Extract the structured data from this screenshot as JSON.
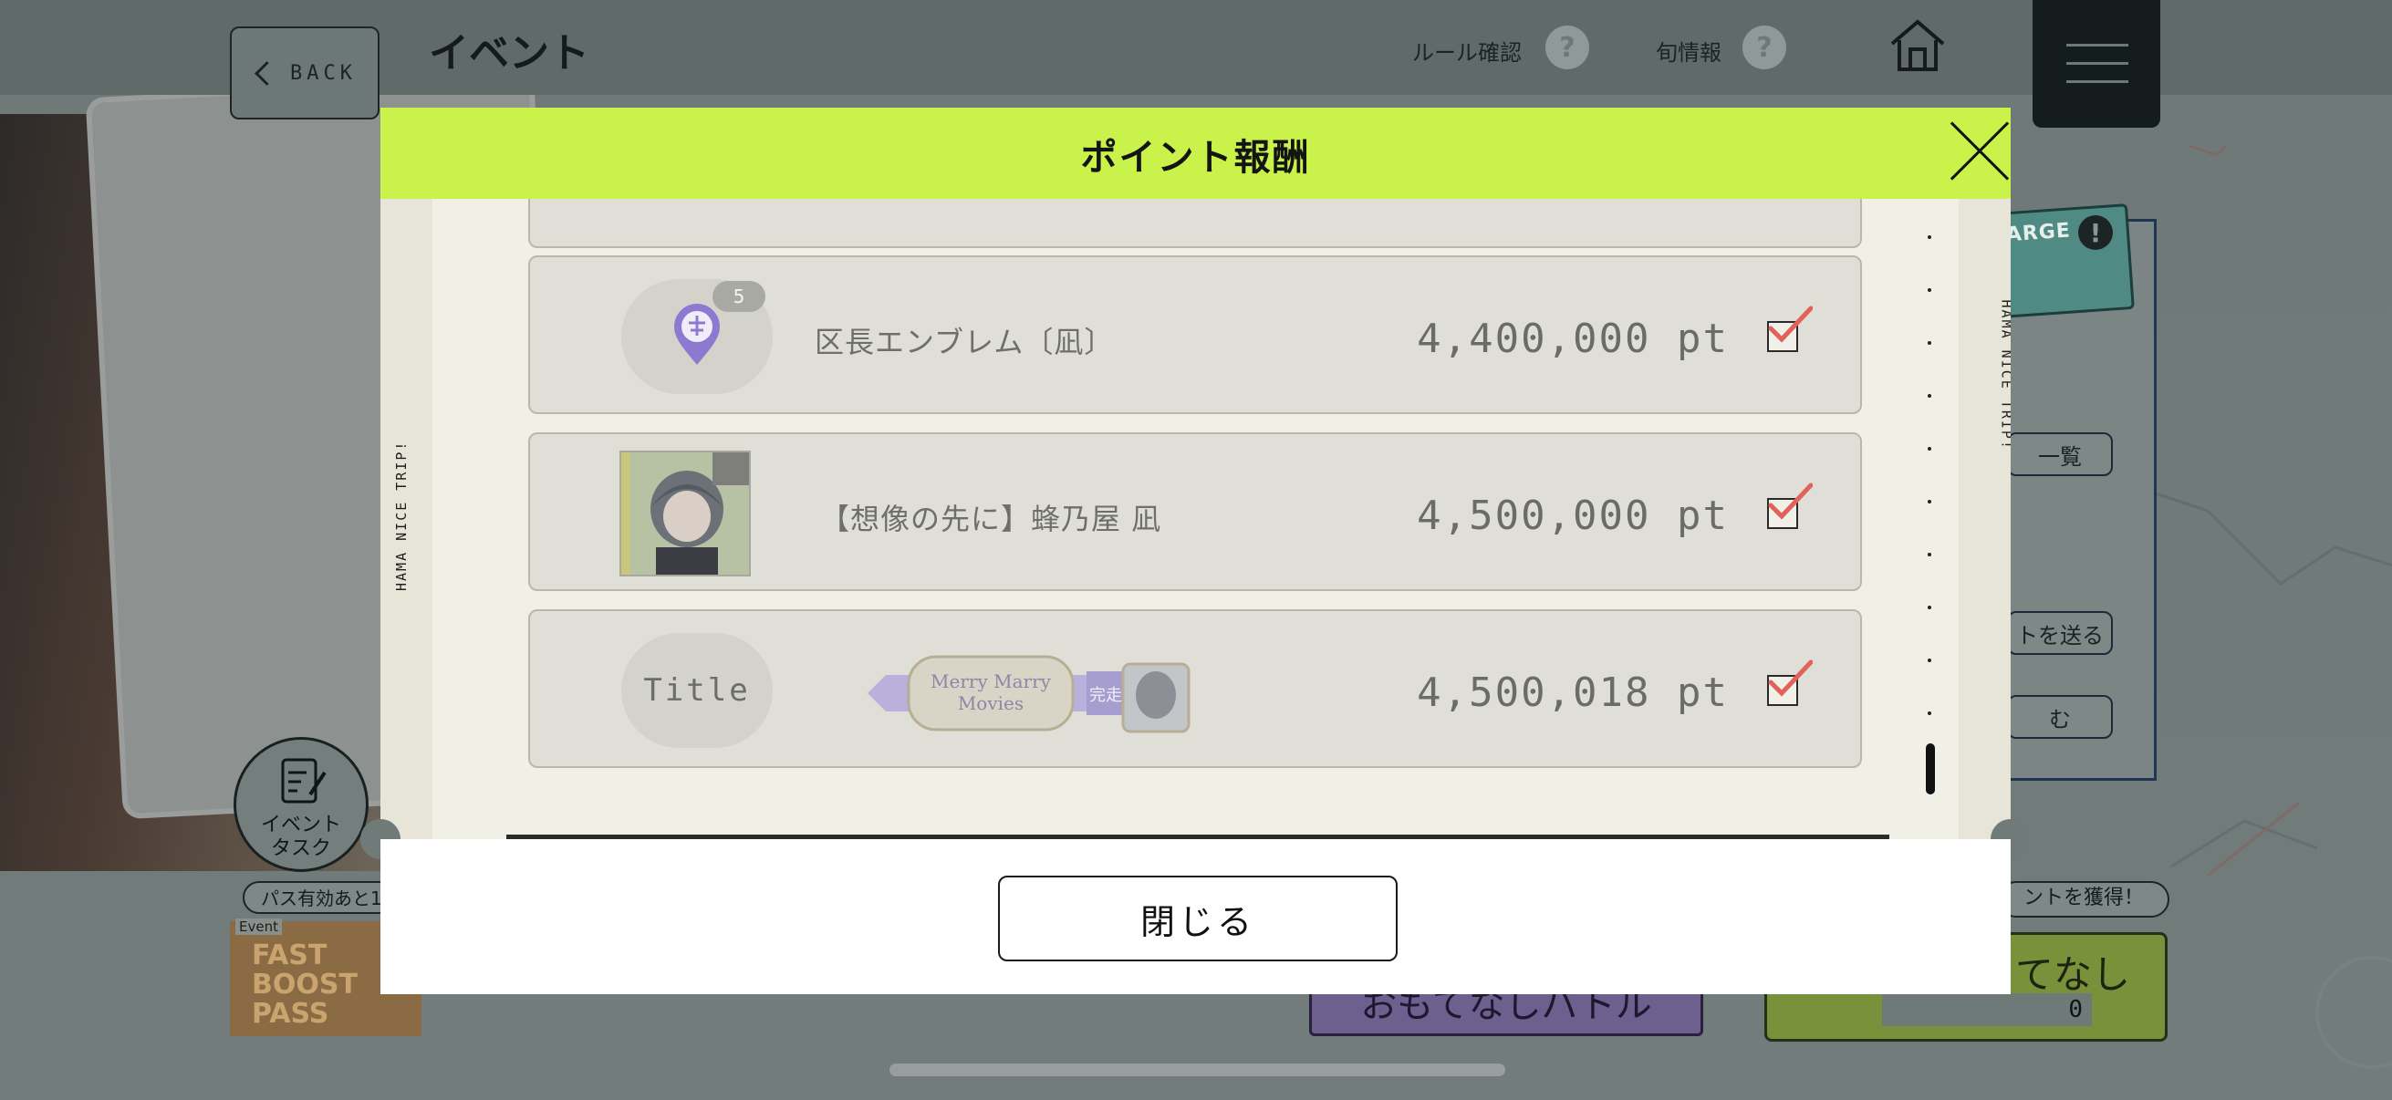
{
  "header": {
    "back_label": "BACK",
    "page_title": "イベント",
    "rules_label": "ルール確認",
    "news_label": "旬情報",
    "help_glyph": "?"
  },
  "background": {
    "event_task_label_1": "イベント",
    "event_task_label_2": "タスク",
    "pass_text": "パス有効あと1",
    "fastpass_event": "Event",
    "fastpass_text": "FAST BOOST PASS",
    "right_panel_badge": "ARGE",
    "right_panel_btn_1": "一覧",
    "right_panel_btn_2": "トを送る",
    "right_panel_btn_3": "む",
    "point_get_text": "ントを獲得！",
    "battle_label": "おもてなしバトル",
    "omotenashi_label": "てなし",
    "counter_value": "0"
  },
  "modal": {
    "title": "ポイント報酬",
    "side_text": "HAMA NICE TRIP!",
    "close_label": "閉じる",
    "rewards": [
      {
        "type": "emblem",
        "name": "区長エンブレム〔凪〕",
        "count": "5",
        "points": "4,400,000 pt",
        "claimed": true
      },
      {
        "type": "card",
        "name": "【想像の先に】蜂乃屋 凪",
        "points": "4,500,000 pt",
        "claimed": true
      },
      {
        "type": "title",
        "name": "Title",
        "banner_text": "Merry Marry Movies",
        "banner_badge": "完走",
        "points": "4,500,018 pt",
        "claimed": true
      }
    ]
  },
  "colors": {
    "header_accent": "#c9f24a",
    "check_red": "#e0625a",
    "emblem_purple": "#8d7ad0"
  }
}
